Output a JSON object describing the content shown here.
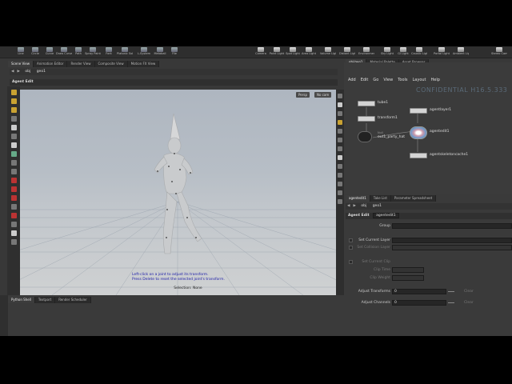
{
  "shelf": {
    "left_tools": [
      "Line",
      "Circle",
      "Curve",
      "Draw Curve",
      "Path",
      "Spray Paint",
      "Font",
      "Platonic Solids",
      "L-System",
      "Metaball",
      "File"
    ],
    "right_tools": [
      "Camera",
      "Point Light",
      "Spot Light",
      "Area Light",
      "Volume Light",
      "Distant Light",
      "Environment Light",
      "Sky Light",
      "GI Light",
      "Caustic Light",
      "Portal Light",
      "Ambient Light",
      "Stereo Camera"
    ]
  },
  "left_pane": {
    "tabs": [
      "Scene View",
      "Animation Editor",
      "Render View",
      "Composite View",
      "Motion FX View"
    ],
    "path": [
      "obj",
      "geo1"
    ],
    "tool_title": "Agent Edit",
    "camera_buttons": [
      "Persp",
      "No cam"
    ],
    "viewport_message": [
      "Left-click on a joint to adjust its transform.",
      "Press Delete to reset the selected joint's transform."
    ],
    "selection_text": "Selection: None",
    "bottom_tabs": [
      "Python Shell",
      "Textport",
      "Render Scheduler"
    ]
  },
  "net_pane": {
    "tabs": [
      "obj/geo1",
      "Material Palette",
      "Asset Browser"
    ],
    "path": [
      "obj",
      "geo1"
    ],
    "menu": [
      "Add",
      "Edit",
      "Go",
      "View",
      "Tools",
      "Layout",
      "Help"
    ],
    "watermark": "CONFIDENTIAL H16.5.333",
    "nodes": [
      {
        "label": "tube1",
        "sub": ""
      },
      {
        "label": "transform1",
        "sub": ""
      },
      {
        "label": "out1_party_hat",
        "sub": "Null"
      },
      {
        "label": "agentlayer1",
        "sub": ""
      },
      {
        "label": "agentedit1",
        "sub": ""
      },
      {
        "label": "agentskeletoncache1",
        "sub": ""
      }
    ]
  },
  "param_pane": {
    "tabs": [
      "agentedit1",
      "Take List",
      "Parameter Spreadsheet"
    ],
    "path": [
      "obj",
      "geo1"
    ],
    "node_type": "Agent Edit",
    "node_name": "agentedit1",
    "params": [
      {
        "label": "Group",
        "value": ""
      },
      {
        "label": "Set Current Layer",
        "value": ""
      },
      {
        "label": "Set Collision Layer",
        "value": ""
      },
      {
        "label": "Set Current Clip",
        "value": ""
      },
      {
        "label": "Clip Time",
        "value": ""
      },
      {
        "label": "Clip Weight",
        "value": ""
      },
      {
        "label": "Adjust Transforms",
        "value": "0",
        "button": "Clear"
      },
      {
        "label": "Adjust Channels",
        "value": "0",
        "button": "Clear"
      }
    ]
  },
  "colors": {
    "panel": "#383838",
    "viewport_sky": "#aeb6c0",
    "message_blue": "#1a1aa8",
    "node_gray": "#d4d4d4"
  }
}
